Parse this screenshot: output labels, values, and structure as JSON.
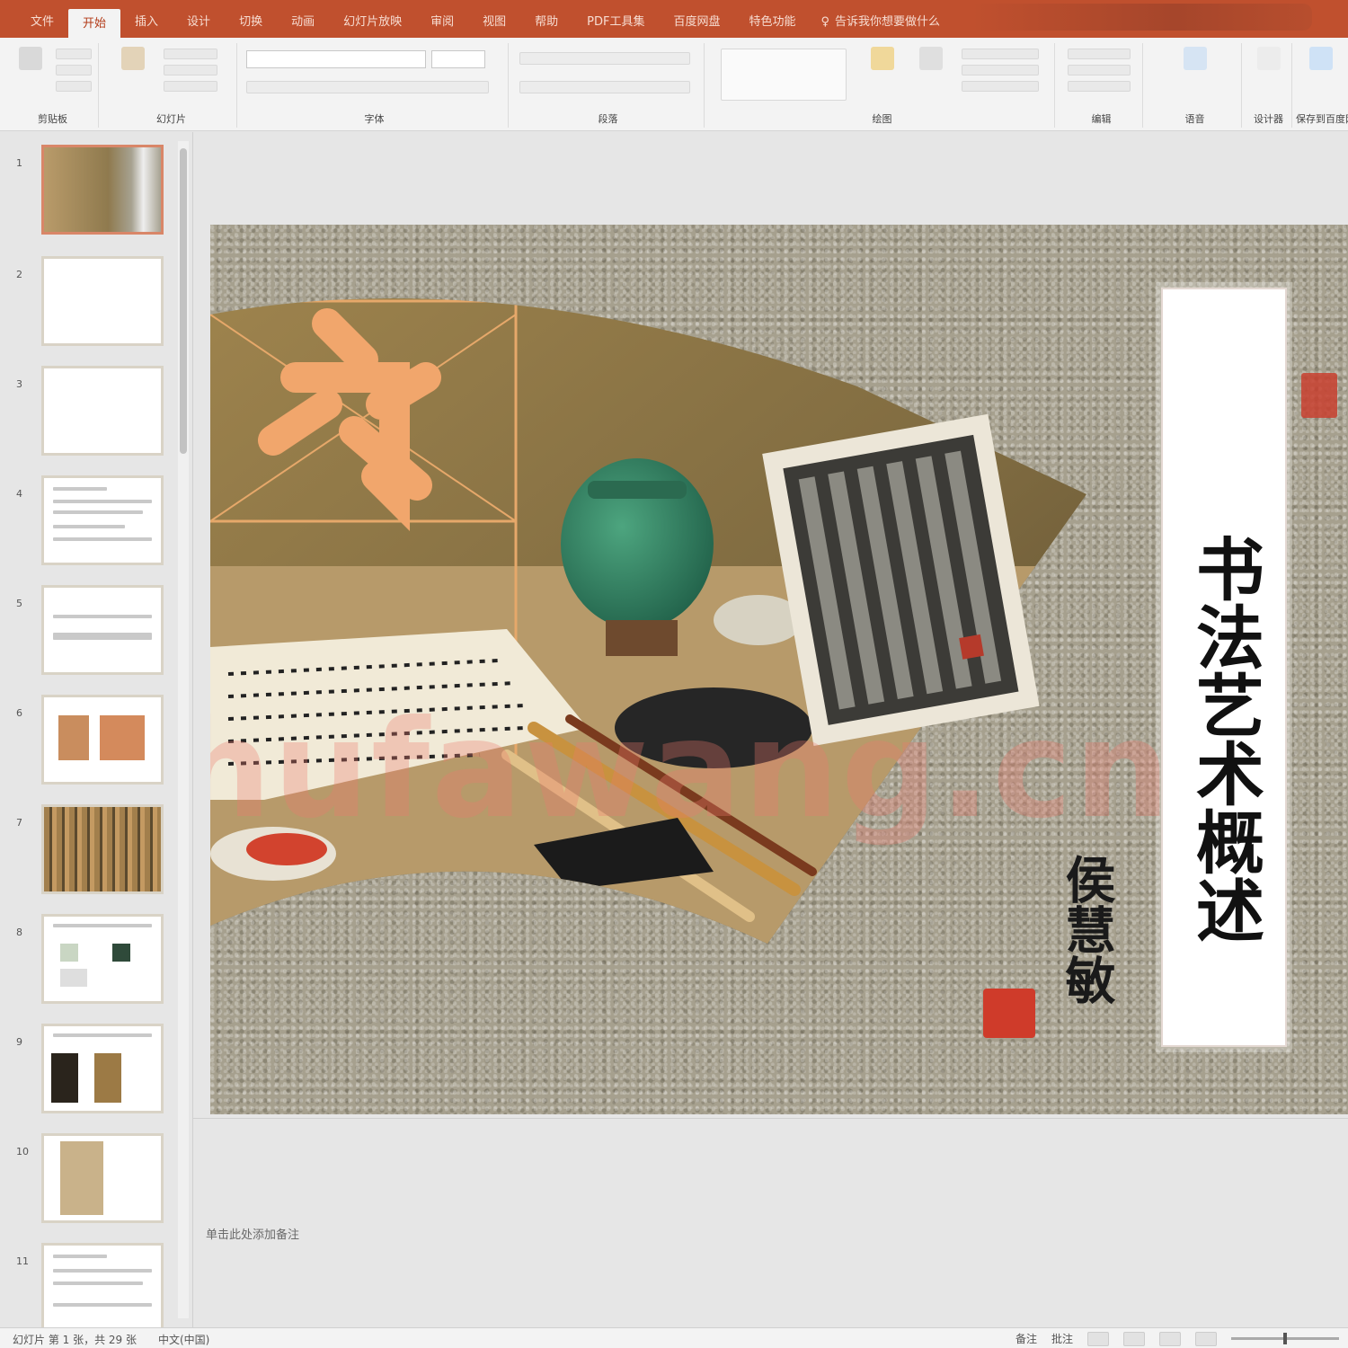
{
  "ribbon_tabs": [
    "文件",
    "开始",
    "插入",
    "设计",
    "切换",
    "动画",
    "幻灯片放映",
    "审阅",
    "视图",
    "帮助",
    "PDF工具集",
    "百度网盘",
    "特色功能",
    "告诉我你想要做什么"
  ],
  "active_tab_index": 1,
  "ribbon_groups": [
    "剪贴板",
    "幻灯片",
    "字体",
    "段落",
    "绘图",
    "编辑",
    "语音",
    "设计器",
    "保存到百度网盘"
  ],
  "font_name_placeholder": "",
  "font_size_placeholder": "",
  "slide_numbers": [
    "1",
    "2",
    "3",
    "4",
    "5",
    "6",
    "7",
    "8",
    "9",
    "10",
    "11"
  ],
  "selected_slide": 1,
  "slide": {
    "title": "书法艺术概述",
    "author": "侯慧敏",
    "watermark": "shufawang.cn"
  },
  "notes_placeholder": "单击此处添加备注",
  "status": {
    "slide_indicator": "幻灯片 第 1 张，共 29 张",
    "language": "中文(中国)",
    "notes_btn": "备注",
    "comments_btn": "批注"
  },
  "colors": {
    "accent": "#c0502e",
    "seal": "#cf3b2a"
  }
}
